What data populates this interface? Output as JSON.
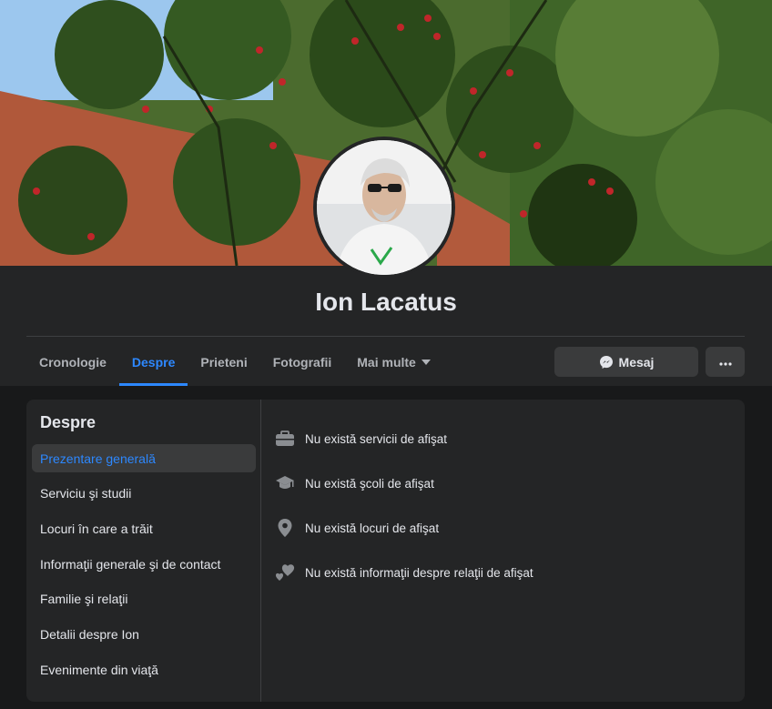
{
  "profile": {
    "name": "Ion Lacatus"
  },
  "tabs": [
    {
      "label": "Cronologie"
    },
    {
      "label": "Despre"
    },
    {
      "label": "Prieteni"
    },
    {
      "label": "Fotografii"
    },
    {
      "label": "Mai multe"
    }
  ],
  "actions": {
    "message_label": "Mesaj",
    "message_icon": "messenger-icon",
    "more_icon": "more-dots-icon"
  },
  "about": {
    "title": "Despre",
    "menu": [
      {
        "label": "Prezentare generală"
      },
      {
        "label": "Serviciu şi studii"
      },
      {
        "label": "Locuri în care a trăit"
      },
      {
        "label": "Informaţii generale şi de contact"
      },
      {
        "label": "Familie şi relaţii"
      },
      {
        "label": "Detalii despre Ion"
      },
      {
        "label": "Evenimente din viaţă"
      }
    ],
    "info": [
      {
        "icon": "briefcase-icon",
        "text": "Nu există servicii de afişat"
      },
      {
        "icon": "graduation-cap-icon",
        "text": "Nu există şcoli de afişat"
      },
      {
        "icon": "location-pin-icon",
        "text": "Nu există locuri de afişat"
      },
      {
        "icon": "hearts-icon",
        "text": "Nu există informaţii despre relaţii de afişat"
      }
    ]
  },
  "colors": {
    "accent": "#2d88ff",
    "background": "#18191a",
    "card": "#242526",
    "button": "#3a3b3c"
  }
}
